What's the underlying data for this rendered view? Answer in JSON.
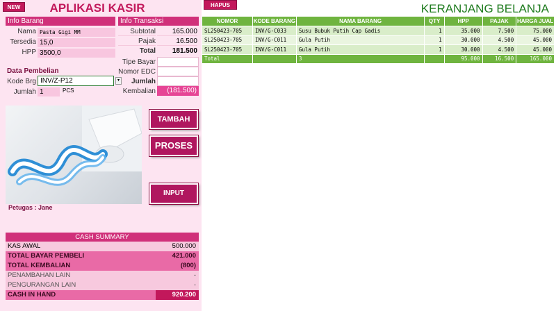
{
  "header": {
    "new_label": "NEW",
    "title": "APLIKASI KASIR",
    "hapus_label": "HAPUS",
    "cart_title": "KERANJANG BELANJA"
  },
  "info_barang": {
    "header": "Info Barang",
    "nama_label": "Nama",
    "nama_value": "Pasta Gigi MM",
    "tersedia_label": "Tersedia",
    "tersedia_value": "15,0",
    "hpp_label": "HPP",
    "hpp_value": "3500,0"
  },
  "info_transaksi": {
    "header": "Info Transaksi",
    "subtotal_label": "Subtotal",
    "subtotal_value": "165.000",
    "pajak_label": "Pajak",
    "pajak_value": "16.500",
    "total_label": "Total",
    "total_value": "181.500",
    "tipe_bayar_label": "Tipe Bayar",
    "tipe_bayar_value": "",
    "nomor_edc_label": "Nomor EDC",
    "nomor_edc_value": "",
    "jumlah_label": "Jumlah",
    "jumlah_value": "",
    "kembalian_label": "Kembalian",
    "kembalian_value": "(181.500)"
  },
  "data_pembelian": {
    "header": "Data Pembelian",
    "kode_label": "Kode Brg",
    "kode_value": "INV/Z-P12",
    "jumlah_label": "Jumlah",
    "jumlah_value": "1",
    "unit": "PCS"
  },
  "buttons": {
    "tambah": "TAMBAH",
    "proses": "PROSES",
    "input": "INPUT"
  },
  "petugas": {
    "label": "Petugas :",
    "name": "Jane"
  },
  "cash_summary": {
    "header": "CASH SUMMARY",
    "rows": [
      {
        "label": "KAS AWAL",
        "value": "500.000"
      },
      {
        "label": "TOTAL BAYAR PEMBELI",
        "value": "421.000"
      },
      {
        "label": "TOTAL KEMBALIAN",
        "value": "(800)"
      },
      {
        "label": "PENAMBAHAN LAIN",
        "value": "-"
      },
      {
        "label": "PENGURANGAN LAIN",
        "value": "-"
      },
      {
        "label": "CASH IN HAND",
        "value": "920.200"
      }
    ]
  },
  "cart": {
    "columns": [
      "NOMOR",
      "KODE BARANG",
      "NAMA BARANG",
      "QTY",
      "HPP",
      "PAJAK",
      "HARGA JUAL"
    ],
    "rows": [
      [
        "SL250423-705",
        "INV/G-C033",
        "Susu Bubuk Putih Cap Gadis",
        "1",
        "35.000",
        "7.500",
        "75.000"
      ],
      [
        "SL250423-705",
        "INV/G-C011",
        "Gula Putih",
        "1",
        "30.000",
        "4.500",
        "45.000"
      ],
      [
        "SL250423-705",
        "INV/G-C011",
        "Gula Putih",
        "1",
        "30.000",
        "4.500",
        "45.000"
      ]
    ],
    "total": [
      "Total",
      "",
      "3",
      "",
      "95.000",
      "16.500",
      "165.000"
    ]
  },
  "colors": {
    "accent": "#c2185b",
    "panel_bg": "#fde4f1",
    "cart_header": "#6fb43f",
    "cart_title": "#1e7b1e"
  },
  "icons": {
    "dropdown": "chevron-down-icon",
    "photo": "toothpaste-photo"
  }
}
